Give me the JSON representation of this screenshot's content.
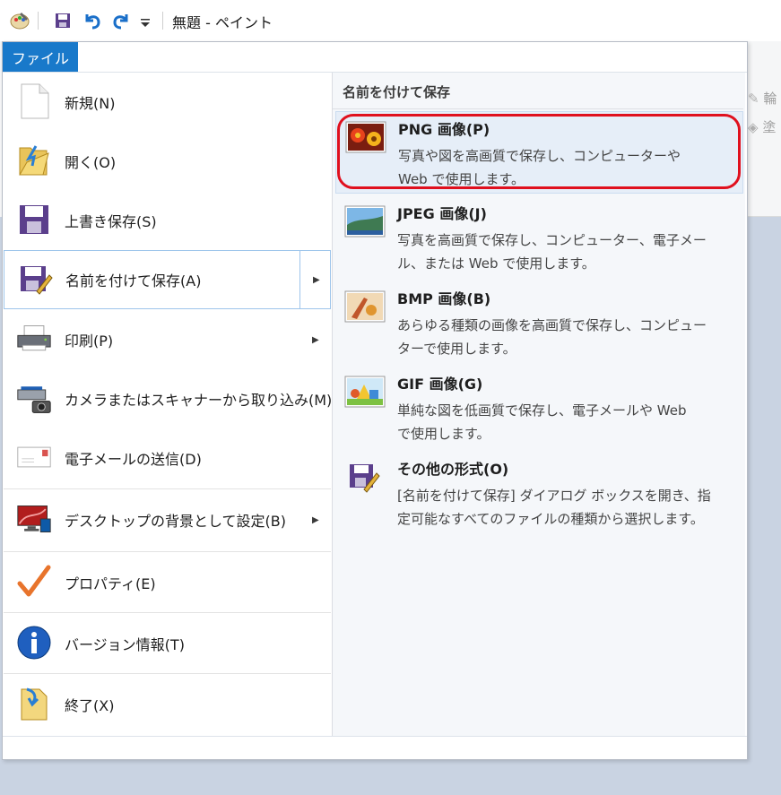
{
  "window": {
    "title": "無題 - ペイント"
  },
  "quick_access": [
    "paint-app-icon",
    "save-icon",
    "undo-icon",
    "redo-icon",
    "customize-qat-icon"
  ],
  "ribbon_ghost": {
    "outline": "輪",
    "fill": "塗"
  },
  "file_tab": {
    "label": "ファイル"
  },
  "menu": {
    "items": [
      {
        "label": "新規(N)",
        "icon": "new-file-icon"
      },
      {
        "label": "開く(O)",
        "icon": "open-folder-icon"
      },
      {
        "label": "上書き保存(S)",
        "icon": "save-icon"
      },
      {
        "label": "名前を付けて保存(A)",
        "icon": "save-as-icon",
        "has_submenu": true,
        "active": true
      },
      {
        "label": "印刷(P)",
        "icon": "printer-icon",
        "has_submenu": true
      },
      {
        "label": "カメラまたはスキャナーから取り込み(M)",
        "icon": "scanner-camera-icon"
      },
      {
        "label": "電子メールの送信(D)",
        "icon": "email-icon"
      },
      {
        "label": "デスクトップの背景として設定(B)",
        "icon": "desktop-background-icon",
        "has_submenu": true
      },
      {
        "label": "プロパティ(E)",
        "icon": "properties-check-icon"
      },
      {
        "label": "バージョン情報(T)",
        "icon": "info-icon"
      },
      {
        "label": "終了(X)",
        "icon": "exit-icon"
      }
    ]
  },
  "save_as_panel": {
    "header": "名前を付けて保存",
    "options": [
      {
        "title": "PNG 画像(P)",
        "desc1": "写真や図を高画質で保存し、コンピューターや",
        "desc2": "Web で使用します。",
        "icon": "png-image-icon",
        "highlighted": true
      },
      {
        "title": "JPEG 画像(J)",
        "desc1": "写真を高画質で保存し、コンピューター、電子メー",
        "desc2": "ル、または Web で使用します。",
        "icon": "jpeg-image-icon"
      },
      {
        "title": "BMP 画像(B)",
        "desc1": "あらゆる種類の画像を高画質で保存し、コンピュー",
        "desc2": "ターで使用します。",
        "icon": "bmp-image-icon"
      },
      {
        "title": "GIF 画像(G)",
        "desc1": "単純な図を低画質で保存し、電子メールや Web",
        "desc2": "で使用します。",
        "icon": "gif-image-icon"
      },
      {
        "title": "その他の形式(O)",
        "desc1": "[名前を付けて保存] ダイアログ ボックスを開き、指",
        "desc2": "定可能なすべてのファイルの種類から選択します。",
        "icon": "other-formats-icon"
      }
    ]
  },
  "colors": {
    "file_tab": "#1979ca",
    "highlight_border": "#e0101e",
    "canvas": "#c9d3e2"
  }
}
